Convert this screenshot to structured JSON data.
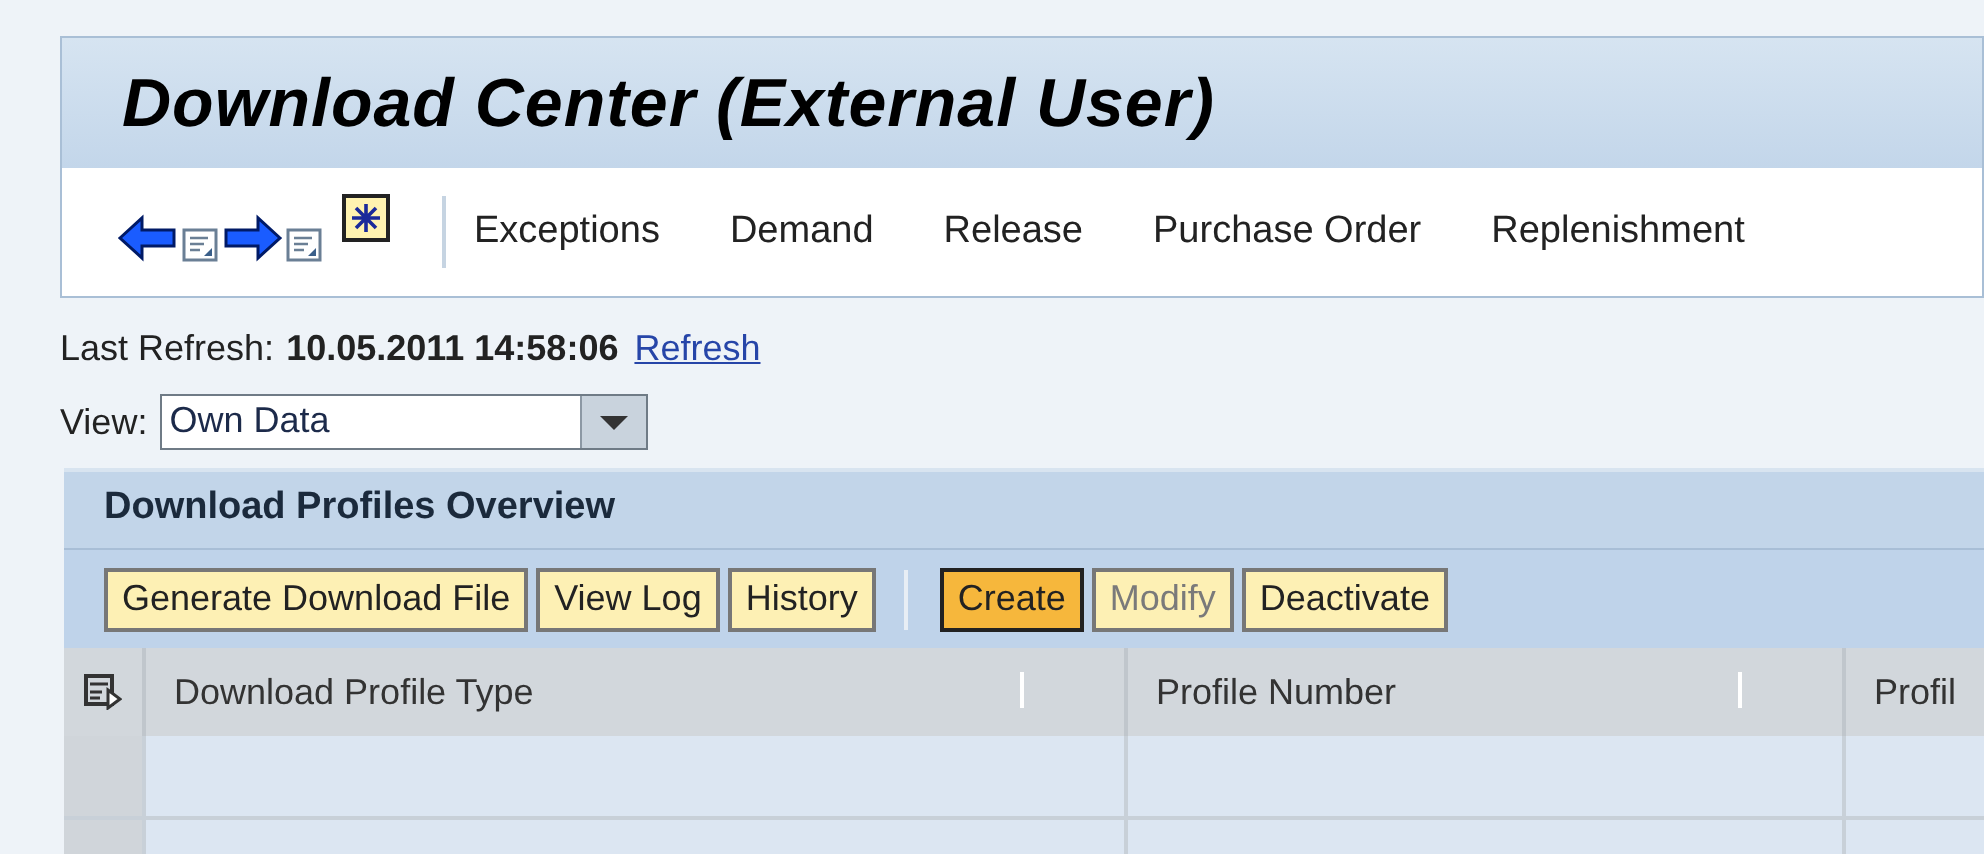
{
  "window": {
    "title": "Download Center (External User)"
  },
  "toolbar": {
    "nav_items": [
      {
        "label": "Exceptions"
      },
      {
        "label": "Demand"
      },
      {
        "label": "Release"
      },
      {
        "label": "Purchase Order"
      },
      {
        "label": "Replenishment"
      }
    ]
  },
  "refresh": {
    "label": "Last Refresh:",
    "timestamp": "10.05.2011 14:58:06",
    "link": "Refresh"
  },
  "view": {
    "label": "View:",
    "value": "Own Data"
  },
  "panel": {
    "title": "Download Profiles Overview",
    "button_groups": [
      [
        {
          "label": "Generate Download File",
          "kind": "normal",
          "disabled": false
        },
        {
          "label": "View Log",
          "kind": "normal",
          "disabled": false
        },
        {
          "label": "History",
          "kind": "normal",
          "disabled": false
        }
      ],
      [
        {
          "label": "Create",
          "kind": "emphasized",
          "disabled": false
        },
        {
          "label": "Modify",
          "kind": "normal",
          "disabled": true
        },
        {
          "label": "Deactivate",
          "kind": "normal",
          "disabled": false
        }
      ]
    ],
    "table": {
      "columns": [
        "Download Profile Type",
        "Profile Number",
        "Profil"
      ]
    }
  }
}
